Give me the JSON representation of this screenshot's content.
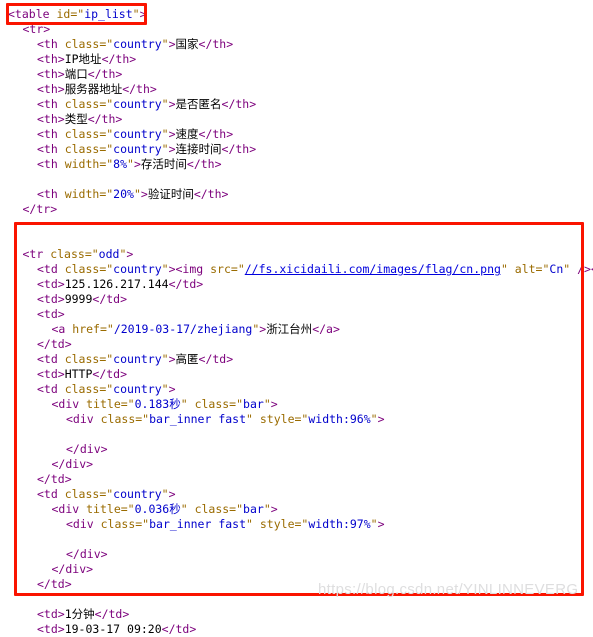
{
  "viewer": {
    "kind": "source-code-screenshot",
    "language": "html",
    "colors": {
      "background": "#ffffff",
      "tag": "#7c007c",
      "attribute": "#9a6b00",
      "value": "#0000cc",
      "text": "#000000",
      "link": "#0000dd",
      "annotation_box": "#fa1400",
      "watermark": "#dededf"
    }
  },
  "watermark": {
    "text": "https://blog.csdn.net/YINLINNEVERG"
  },
  "annotations": [
    {
      "name": "table-tag-highlight",
      "label": "<table id=\"ip_list\">"
    },
    {
      "name": "first-row-highlight",
      "label": "<tr class=\"odd\"> ... </td>"
    }
  ],
  "code": {
    "lines": [
      {
        "indent": 0,
        "tokens": [
          {
            "t": "tag",
            "v": "<table "
          },
          {
            "t": "attr",
            "v": "id="
          },
          {
            "t": "attr",
            "v": "\""
          },
          {
            "t": "val",
            "v": "ip_list"
          },
          {
            "t": "attr",
            "v": "\""
          },
          {
            "t": "tag",
            "v": ">"
          }
        ]
      },
      {
        "indent": 1,
        "tokens": [
          {
            "t": "tag",
            "v": "<tr>"
          }
        ]
      },
      {
        "indent": 2,
        "tokens": [
          {
            "t": "tag",
            "v": "<th "
          },
          {
            "t": "attr",
            "v": "class=\""
          },
          {
            "t": "val",
            "v": "country"
          },
          {
            "t": "attr",
            "v": "\""
          },
          {
            "t": "tag",
            "v": ">"
          },
          {
            "t": "text",
            "v": "国家"
          },
          {
            "t": "tag",
            "v": "</th>"
          }
        ]
      },
      {
        "indent": 2,
        "tokens": [
          {
            "t": "tag",
            "v": "<th>"
          },
          {
            "t": "text",
            "v": "IP地址"
          },
          {
            "t": "tag",
            "v": "</th>"
          }
        ]
      },
      {
        "indent": 2,
        "tokens": [
          {
            "t": "tag",
            "v": "<th>"
          },
          {
            "t": "text",
            "v": "端口"
          },
          {
            "t": "tag",
            "v": "</th>"
          }
        ]
      },
      {
        "indent": 2,
        "tokens": [
          {
            "t": "tag",
            "v": "<th>"
          },
          {
            "t": "text",
            "v": "服务器地址"
          },
          {
            "t": "tag",
            "v": "</th>"
          }
        ]
      },
      {
        "indent": 2,
        "tokens": [
          {
            "t": "tag",
            "v": "<th "
          },
          {
            "t": "attr",
            "v": "class=\""
          },
          {
            "t": "val",
            "v": "country"
          },
          {
            "t": "attr",
            "v": "\""
          },
          {
            "t": "tag",
            "v": ">"
          },
          {
            "t": "text",
            "v": "是否匿名"
          },
          {
            "t": "tag",
            "v": "</th>"
          }
        ]
      },
      {
        "indent": 2,
        "tokens": [
          {
            "t": "tag",
            "v": "<th>"
          },
          {
            "t": "text",
            "v": "类型"
          },
          {
            "t": "tag",
            "v": "</th>"
          }
        ]
      },
      {
        "indent": 2,
        "tokens": [
          {
            "t": "tag",
            "v": "<th "
          },
          {
            "t": "attr",
            "v": "class=\""
          },
          {
            "t": "val",
            "v": "country"
          },
          {
            "t": "attr",
            "v": "\""
          },
          {
            "t": "tag",
            "v": ">"
          },
          {
            "t": "text",
            "v": "速度"
          },
          {
            "t": "tag",
            "v": "</th>"
          }
        ]
      },
      {
        "indent": 2,
        "tokens": [
          {
            "t": "tag",
            "v": "<th "
          },
          {
            "t": "attr",
            "v": "class=\""
          },
          {
            "t": "val",
            "v": "country"
          },
          {
            "t": "attr",
            "v": "\""
          },
          {
            "t": "tag",
            "v": ">"
          },
          {
            "t": "text",
            "v": "连接时间"
          },
          {
            "t": "tag",
            "v": "</th>"
          }
        ]
      },
      {
        "indent": 2,
        "tokens": [
          {
            "t": "tag",
            "v": "<th "
          },
          {
            "t": "attr",
            "v": "width=\""
          },
          {
            "t": "val",
            "v": "8%"
          },
          {
            "t": "attr",
            "v": "\""
          },
          {
            "t": "tag",
            "v": ">"
          },
          {
            "t": "text",
            "v": "存活时间"
          },
          {
            "t": "tag",
            "v": "</th>"
          }
        ]
      },
      {
        "indent": 0,
        "tokens": []
      },
      {
        "indent": 2,
        "tokens": [
          {
            "t": "tag",
            "v": "<th "
          },
          {
            "t": "attr",
            "v": "width=\""
          },
          {
            "t": "val",
            "v": "20%"
          },
          {
            "t": "attr",
            "v": "\""
          },
          {
            "t": "tag",
            "v": ">"
          },
          {
            "t": "text",
            "v": "验证时间"
          },
          {
            "t": "tag",
            "v": "</th>"
          }
        ]
      },
      {
        "indent": 1,
        "tokens": [
          {
            "t": "tag",
            "v": "</tr>"
          }
        ]
      },
      {
        "indent": 0,
        "tokens": []
      },
      {
        "indent": 0,
        "tokens": []
      },
      {
        "indent": 1,
        "tokens": [
          {
            "t": "tag",
            "v": "<tr "
          },
          {
            "t": "attr",
            "v": "class=\""
          },
          {
            "t": "val",
            "v": "odd"
          },
          {
            "t": "attr",
            "v": "\""
          },
          {
            "t": "tag",
            "v": ">"
          }
        ]
      },
      {
        "indent": 2,
        "tokens": [
          {
            "t": "tag",
            "v": "<td "
          },
          {
            "t": "attr",
            "v": "class=\""
          },
          {
            "t": "val",
            "v": "country"
          },
          {
            "t": "attr",
            "v": "\""
          },
          {
            "t": "tag",
            "v": "><img "
          },
          {
            "t": "attr",
            "v": "src=\""
          },
          {
            "t": "link",
            "v": "//fs.xicidaili.com/images/flag/cn.png"
          },
          {
            "t": "attr",
            "v": "\" alt=\""
          },
          {
            "t": "val",
            "v": "Cn"
          },
          {
            "t": "attr",
            "v": "\" "
          },
          {
            "t": "tag",
            "v": "/></td>"
          }
        ]
      },
      {
        "indent": 2,
        "tokens": [
          {
            "t": "tag",
            "v": "<td>"
          },
          {
            "t": "text",
            "v": "125.126.217.144"
          },
          {
            "t": "tag",
            "v": "</td>"
          }
        ]
      },
      {
        "indent": 2,
        "tokens": [
          {
            "t": "tag",
            "v": "<td>"
          },
          {
            "t": "text",
            "v": "9999"
          },
          {
            "t": "tag",
            "v": "</td>"
          }
        ]
      },
      {
        "indent": 2,
        "tokens": [
          {
            "t": "tag",
            "v": "<td>"
          }
        ]
      },
      {
        "indent": 3,
        "tokens": [
          {
            "t": "tag",
            "v": "<a "
          },
          {
            "t": "attr",
            "v": "href=\""
          },
          {
            "t": "val",
            "v": "/2019-03-17/zhejiang"
          },
          {
            "t": "attr",
            "v": "\""
          },
          {
            "t": "tag",
            "v": ">"
          },
          {
            "t": "text",
            "v": "浙江台州"
          },
          {
            "t": "tag",
            "v": "</a>"
          }
        ]
      },
      {
        "indent": 2,
        "tokens": [
          {
            "t": "tag",
            "v": "</td>"
          }
        ]
      },
      {
        "indent": 2,
        "tokens": [
          {
            "t": "tag",
            "v": "<td "
          },
          {
            "t": "attr",
            "v": "class=\""
          },
          {
            "t": "val",
            "v": "country"
          },
          {
            "t": "attr",
            "v": "\""
          },
          {
            "t": "tag",
            "v": ">"
          },
          {
            "t": "text",
            "v": "高匿"
          },
          {
            "t": "tag",
            "v": "</td>"
          }
        ]
      },
      {
        "indent": 2,
        "tokens": [
          {
            "t": "tag",
            "v": "<td>"
          },
          {
            "t": "text",
            "v": "HTTP"
          },
          {
            "t": "tag",
            "v": "</td>"
          }
        ]
      },
      {
        "indent": 2,
        "tokens": [
          {
            "t": "tag",
            "v": "<td "
          },
          {
            "t": "attr",
            "v": "class=\""
          },
          {
            "t": "val",
            "v": "country"
          },
          {
            "t": "attr",
            "v": "\""
          },
          {
            "t": "tag",
            "v": ">"
          }
        ]
      },
      {
        "indent": 3,
        "tokens": [
          {
            "t": "tag",
            "v": "<div "
          },
          {
            "t": "attr",
            "v": "title=\""
          },
          {
            "t": "val",
            "v": "0.183秒"
          },
          {
            "t": "attr",
            "v": "\" class=\""
          },
          {
            "t": "val",
            "v": "bar"
          },
          {
            "t": "attr",
            "v": "\""
          },
          {
            "t": "tag",
            "v": ">"
          }
        ]
      },
      {
        "indent": 4,
        "tokens": [
          {
            "t": "tag",
            "v": "<div "
          },
          {
            "t": "attr",
            "v": "class=\""
          },
          {
            "t": "val",
            "v": "bar_inner fast"
          },
          {
            "t": "attr",
            "v": "\" style=\""
          },
          {
            "t": "val",
            "v": "width:96%"
          },
          {
            "t": "attr",
            "v": "\""
          },
          {
            "t": "tag",
            "v": ">"
          }
        ]
      },
      {
        "indent": 0,
        "tokens": []
      },
      {
        "indent": 4,
        "tokens": [
          {
            "t": "tag",
            "v": "</div>"
          }
        ]
      },
      {
        "indent": 3,
        "tokens": [
          {
            "t": "tag",
            "v": "</div>"
          }
        ]
      },
      {
        "indent": 2,
        "tokens": [
          {
            "t": "tag",
            "v": "</td>"
          }
        ]
      },
      {
        "indent": 2,
        "tokens": [
          {
            "t": "tag",
            "v": "<td "
          },
          {
            "t": "attr",
            "v": "class=\""
          },
          {
            "t": "val",
            "v": "country"
          },
          {
            "t": "attr",
            "v": "\""
          },
          {
            "t": "tag",
            "v": ">"
          }
        ]
      },
      {
        "indent": 3,
        "tokens": [
          {
            "t": "tag",
            "v": "<div "
          },
          {
            "t": "attr",
            "v": "title=\""
          },
          {
            "t": "val",
            "v": "0.036秒"
          },
          {
            "t": "attr",
            "v": "\" class=\""
          },
          {
            "t": "val",
            "v": "bar"
          },
          {
            "t": "attr",
            "v": "\""
          },
          {
            "t": "tag",
            "v": ">"
          }
        ]
      },
      {
        "indent": 4,
        "tokens": [
          {
            "t": "tag",
            "v": "<div "
          },
          {
            "t": "attr",
            "v": "class=\""
          },
          {
            "t": "val",
            "v": "bar_inner fast"
          },
          {
            "t": "attr",
            "v": "\" style=\""
          },
          {
            "t": "val",
            "v": "width:97%"
          },
          {
            "t": "attr",
            "v": "\""
          },
          {
            "t": "tag",
            "v": ">"
          }
        ]
      },
      {
        "indent": 0,
        "tokens": []
      },
      {
        "indent": 4,
        "tokens": [
          {
            "t": "tag",
            "v": "</div>"
          }
        ]
      },
      {
        "indent": 3,
        "tokens": [
          {
            "t": "tag",
            "v": "</div>"
          }
        ]
      },
      {
        "indent": 2,
        "tokens": [
          {
            "t": "tag",
            "v": "</td>"
          }
        ]
      },
      {
        "indent": 0,
        "tokens": []
      },
      {
        "indent": 2,
        "tokens": [
          {
            "t": "tag",
            "v": "<td>"
          },
          {
            "t": "text",
            "v": "1分钟"
          },
          {
            "t": "tag",
            "v": "</td>"
          }
        ]
      },
      {
        "indent": 2,
        "tokens": [
          {
            "t": "tag",
            "v": "<td>"
          },
          {
            "t": "text",
            "v": "19-03-17 09:20"
          },
          {
            "t": "tag",
            "v": "</td>"
          }
        ]
      }
    ]
  }
}
